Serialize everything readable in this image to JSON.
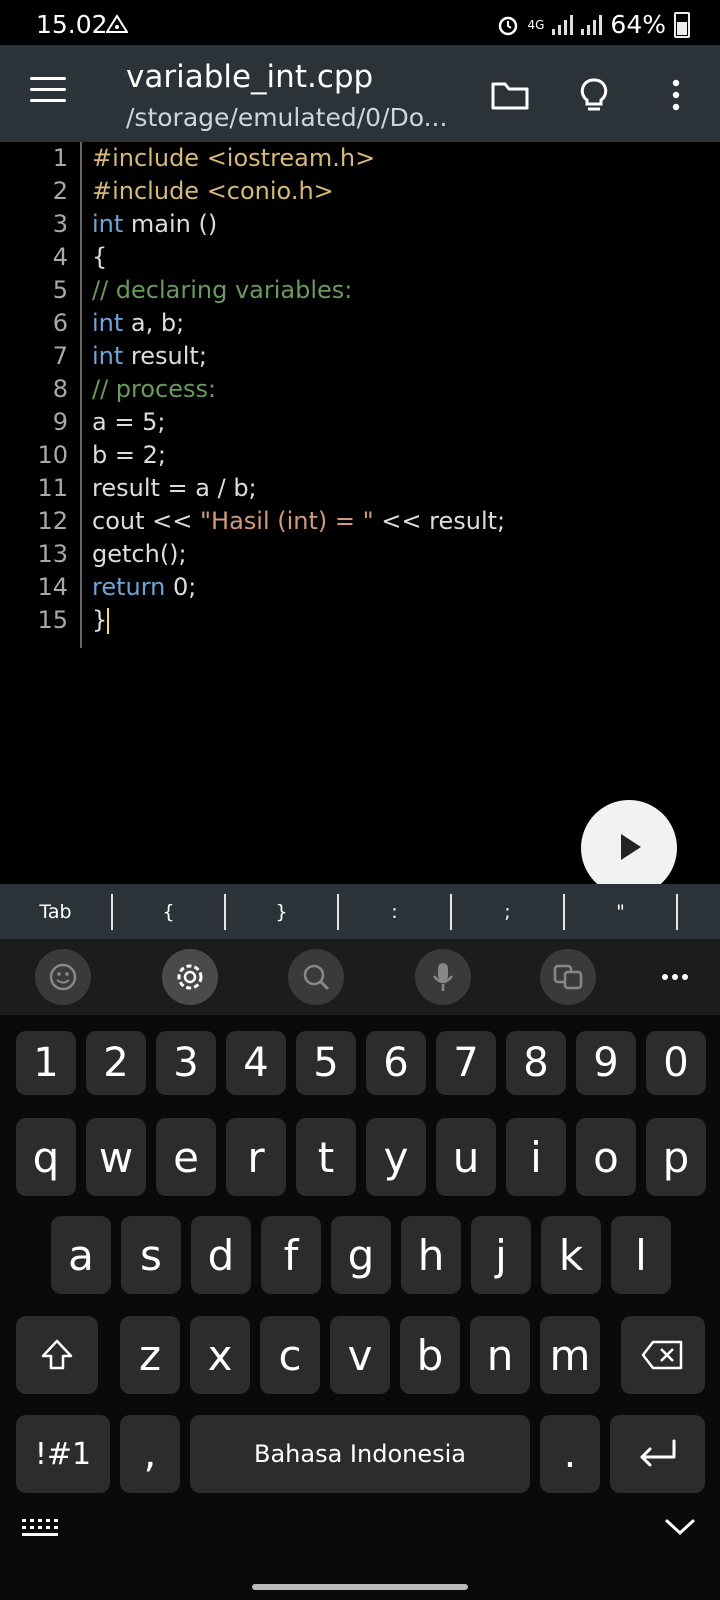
{
  "status": {
    "time": "15.02",
    "network": "4G",
    "battery": "64%"
  },
  "app_bar": {
    "title": "variable_int.cpp",
    "path": "/storage/emulated/0/Do...",
    "icons": [
      "menu-icon",
      "folder-icon",
      "bulb-icon",
      "more-vert-icon"
    ]
  },
  "editor": {
    "lines": [
      {
        "n": "1",
        "parts": [
          [
            "pp",
            "#include <iostream.h>"
          ]
        ]
      },
      {
        "n": "2",
        "parts": [
          [
            "pp",
            "#include <conio.h>"
          ]
        ]
      },
      {
        "n": "3",
        "parts": [
          [
            "kw",
            "int"
          ],
          [
            "",
            " main ()"
          ]
        ]
      },
      {
        "n": "4",
        "parts": [
          [
            "",
            "{"
          ]
        ]
      },
      {
        "n": "5",
        "parts": [
          [
            "cm",
            "// declaring variables:"
          ]
        ]
      },
      {
        "n": "6",
        "parts": [
          [
            "kw",
            "int"
          ],
          [
            "",
            " a, b;"
          ]
        ]
      },
      {
        "n": "7",
        "parts": [
          [
            "kw",
            "int"
          ],
          [
            "",
            " result;"
          ]
        ]
      },
      {
        "n": "8",
        "parts": [
          [
            "cm",
            "// process:"
          ]
        ]
      },
      {
        "n": "9",
        "parts": [
          [
            "",
            "a = 5;"
          ]
        ]
      },
      {
        "n": "10",
        "parts": [
          [
            "",
            "b = 2;"
          ]
        ]
      },
      {
        "n": "11",
        "parts": [
          [
            "",
            "result = a / b;"
          ]
        ]
      },
      {
        "n": "12",
        "parts": [
          [
            "",
            "cout << "
          ],
          [
            "st",
            "\"Hasil (int) = \""
          ],
          [
            "",
            " << result;"
          ]
        ]
      },
      {
        "n": "13",
        "parts": [
          [
            "",
            "getch();"
          ]
        ]
      },
      {
        "n": "14",
        "parts": [
          [
            "kw",
            "return"
          ],
          [
            "",
            " 0;"
          ]
        ]
      },
      {
        "n": "15",
        "parts": [
          [
            "",
            "}"
          ]
        ]
      }
    ]
  },
  "symbol_bar": [
    "Tab",
    "{",
    "}",
    ":",
    ";",
    "\""
  ],
  "keyboard": {
    "toolbar_icons": [
      "emoji-icon",
      "settings-icon",
      "search-icon",
      "mic-icon",
      "translate-icon",
      "more-icon"
    ],
    "numbers": [
      "1",
      "2",
      "3",
      "4",
      "5",
      "6",
      "7",
      "8",
      "9",
      "0"
    ],
    "row1": [
      "q",
      "w",
      "e",
      "r",
      "t",
      "y",
      "u",
      "i",
      "o",
      "p"
    ],
    "row2": [
      "a",
      "s",
      "d",
      "f",
      "g",
      "h",
      "j",
      "k",
      "l"
    ],
    "row3": [
      "z",
      "x",
      "c",
      "v",
      "b",
      "n",
      "m"
    ],
    "symbols_key": "!#1",
    "comma_key": ",",
    "space_label": "Bahasa Indonesia",
    "period_key": "."
  }
}
